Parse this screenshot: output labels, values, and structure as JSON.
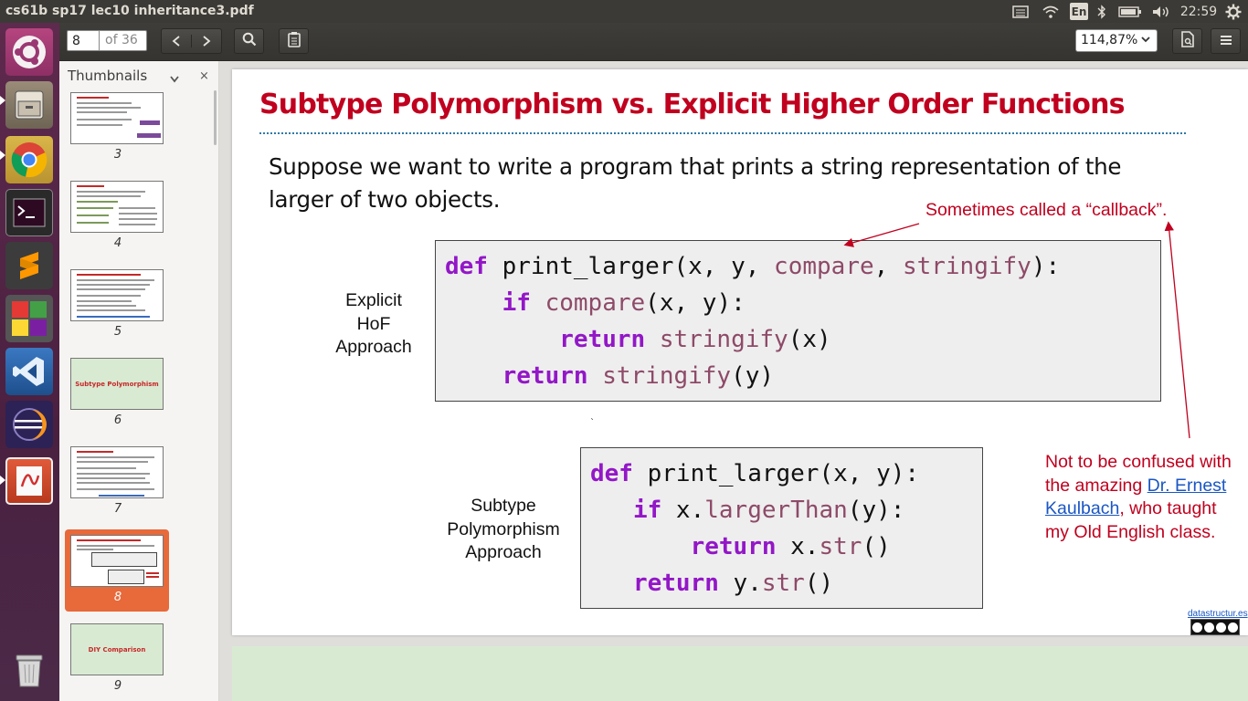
{
  "window": {
    "title": "cs61b sp17 lec10 inheritance3.pdf"
  },
  "system_tray": {
    "keyboard_layout": "En",
    "clock": "22:59"
  },
  "toolbar": {
    "page_number": "8",
    "page_count": "of 36",
    "zoom": "114,87%"
  },
  "sidebar": {
    "title": "Thumbnails",
    "thumbnails": [
      {
        "number": "3"
      },
      {
        "number": "4"
      },
      {
        "number": "5"
      },
      {
        "number": "6",
        "text": "Subtype Polymorphism"
      },
      {
        "number": "7"
      },
      {
        "number": "8",
        "selected": true
      },
      {
        "number": "9",
        "text": "DIY Comparison"
      }
    ]
  },
  "slide": {
    "title": "Subtype Polymorphism vs. Explicit Higher Order Functions",
    "intro": "Suppose we want to write a program that prints a string representation of the larger of two objects.",
    "callback_note": "Sometimes called a “callback”.",
    "hof_label": [
      "Explicit",
      "HoF",
      "Approach"
    ],
    "subtype_label": [
      "Subtype",
      "Polymorphism",
      "Approach"
    ],
    "code_hof": [
      [
        {
          "t": "def",
          "c": "kw"
        },
        {
          "t": " print_larger(x, y, ",
          "c": ""
        },
        {
          "t": "compare",
          "c": "id"
        },
        {
          "t": ", ",
          "c": ""
        },
        {
          "t": "stringify",
          "c": "id"
        },
        {
          "t": "):",
          "c": ""
        }
      ],
      [
        {
          "t": "    ",
          "c": ""
        },
        {
          "t": "if",
          "c": "kw"
        },
        {
          "t": " ",
          "c": ""
        },
        {
          "t": "compare",
          "c": "id"
        },
        {
          "t": "(x, y):",
          "c": ""
        }
      ],
      [
        {
          "t": "        ",
          "c": ""
        },
        {
          "t": "return",
          "c": "kw"
        },
        {
          "t": " ",
          "c": ""
        },
        {
          "t": "stringify",
          "c": "id"
        },
        {
          "t": "(x)",
          "c": ""
        }
      ],
      [
        {
          "t": "    ",
          "c": ""
        },
        {
          "t": "return",
          "c": "kw"
        },
        {
          "t": " ",
          "c": ""
        },
        {
          "t": "stringify",
          "c": "id"
        },
        {
          "t": "(y)",
          "c": ""
        }
      ]
    ],
    "code_subtype": [
      [
        {
          "t": "def",
          "c": "kw"
        },
        {
          "t": " print_larger(x, y):",
          "c": ""
        }
      ],
      [
        {
          "t": "   ",
          "c": ""
        },
        {
          "t": "if",
          "c": "kw"
        },
        {
          "t": " x.",
          "c": ""
        },
        {
          "t": "largerThan",
          "c": "id"
        },
        {
          "t": "(y):",
          "c": ""
        }
      ],
      [
        {
          "t": "       ",
          "c": ""
        },
        {
          "t": "return",
          "c": "kw"
        },
        {
          "t": " x.",
          "c": ""
        },
        {
          "t": "str",
          "c": "id"
        },
        {
          "t": "()",
          "c": ""
        }
      ],
      [
        {
          "t": "   ",
          "c": ""
        },
        {
          "t": "return",
          "c": "kw"
        },
        {
          "t": " y.",
          "c": ""
        },
        {
          "t": "str",
          "c": "id"
        },
        {
          "t": "()",
          "c": ""
        }
      ]
    ],
    "confused_before": "Not to be confused with the amazing ",
    "confused_link": "Dr. Ernest Kaulbach",
    "confused_after": ", who taught my Old English class.",
    "footer_link": "datastructur.es",
    "colors": {
      "title": "#c0001e",
      "keyword": "#9317c7",
      "identifier": "#8e4a68",
      "link": "#1a56c4",
      "selected_thumb": "#e8693a"
    }
  }
}
